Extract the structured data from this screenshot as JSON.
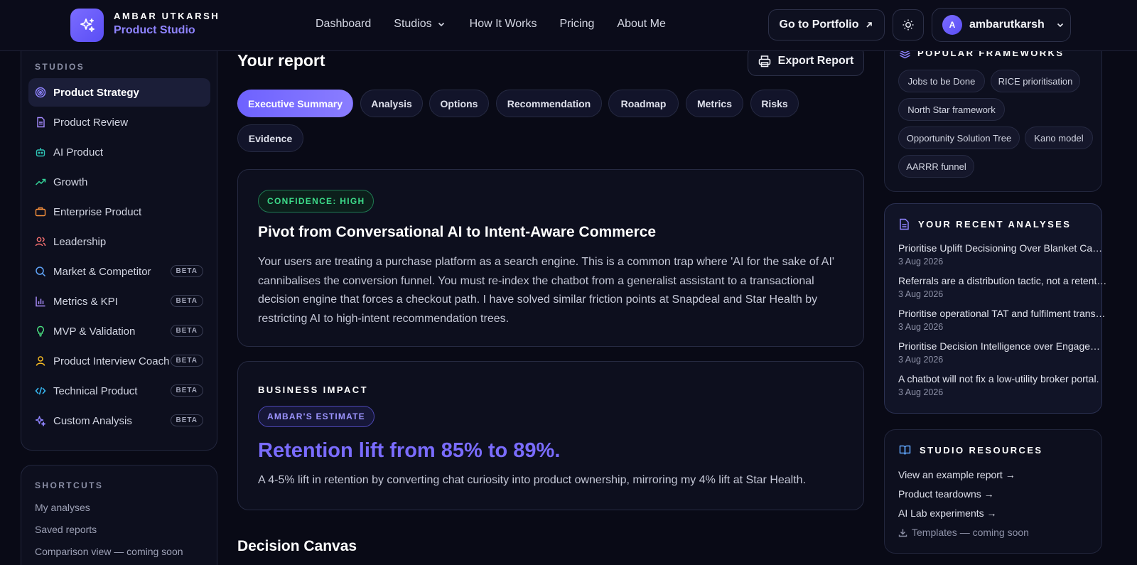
{
  "brand": {
    "line1": "AMBAR UTKARSH",
    "line2": "Product Studio"
  },
  "nav": {
    "dashboard": "Dashboard",
    "studios": "Studios",
    "how_it_works": "How It Works",
    "pricing": "Pricing",
    "about": "About Me",
    "portfolio_button": "Go to Portfolio",
    "user_initial": "A",
    "username": "ambarutkarsh"
  },
  "sidebar": {
    "studios_label": "STUDIOS",
    "items": [
      {
        "label": "Product Strategy",
        "icon": "target-icon",
        "beta": "",
        "active": true
      },
      {
        "label": "Product Review",
        "icon": "document-icon",
        "beta": ""
      },
      {
        "label": "AI Product",
        "icon": "bot-icon",
        "beta": ""
      },
      {
        "label": "Growth",
        "icon": "trending-up-icon",
        "beta": ""
      },
      {
        "label": "Enterprise Product",
        "icon": "briefcase-icon",
        "beta": ""
      },
      {
        "label": "Leadership",
        "icon": "users-icon",
        "beta": ""
      },
      {
        "label": "Market & Competitor",
        "icon": "search-icon",
        "beta": "BETA"
      },
      {
        "label": "Metrics & KPI",
        "icon": "bar-chart-icon",
        "beta": "BETA"
      },
      {
        "label": "MVP & Validation",
        "icon": "lightbulb-icon",
        "beta": "BETA"
      },
      {
        "label": "Product Interview Coach",
        "icon": "user-icon",
        "beta": "BETA"
      },
      {
        "label": "Technical Product",
        "icon": "code-icon",
        "beta": "BETA"
      },
      {
        "label": "Custom Analysis",
        "icon": "sparkles-icon",
        "beta": "BETA"
      }
    ],
    "shortcuts_label": "SHORTCUTS",
    "shortcuts": [
      "My analyses",
      "Saved reports",
      "Comparison view — coming soon"
    ]
  },
  "main": {
    "title": "Your report",
    "export_button": "Export Report",
    "tabs": [
      "Executive Summary",
      "Analysis",
      "Options",
      "Recommendation",
      "Roadmap",
      "Metrics",
      "Risks",
      "Evidence"
    ],
    "summary": {
      "confidence": "CONFIDENCE: HIGH",
      "heading": "Pivot from Conversational AI to Intent-Aware Commerce",
      "body": "Your users are treating a purchase platform as a search engine. This is a common trap where 'AI for the sake of AI' cannibalises the conversion funnel. You must re-index the chatbot from a generalist assistant to a transactional decision engine that forces a checkout path. I have solved similar friction points at Snapdeal and Star Health by restricting AI to high-intent recommendation trees."
    },
    "impact": {
      "label": "BUSINESS IMPACT",
      "badge": "AMBAR'S ESTIMATE",
      "heading": "Retention lift from 85% to 89%.",
      "body": "A 4-5% lift in retention by converting chat curiosity into product ownership, mirroring my 4% lift at Star Health."
    },
    "canvas_title": "Decision Canvas"
  },
  "right": {
    "frameworks_label": "POPULAR FRAMEWORKS",
    "frameworks": [
      "Jobs to be Done",
      "RICE prioritisation",
      "North Star framework",
      "Opportunity Solution Tree",
      "Kano model",
      "AARRR funnel"
    ],
    "recent_label": "YOUR RECENT ANALYSES",
    "recent": [
      {
        "title": "Prioritise Uplift Decisioning Over Blanket Cam...",
        "date": "3 Aug 2026"
      },
      {
        "title": "Referrals are a distribution tactic, not a retenti...",
        "date": "3 Aug 2026"
      },
      {
        "title": "Prioritise operational TAT and fulfilment transp...",
        "date": "3 Aug 2026"
      },
      {
        "title": "Prioritise Decision Intelligence over Engageme...",
        "date": "3 Aug 2026"
      },
      {
        "title": "A chatbot will not fix a low-utility broker portal.",
        "date": "3 Aug 2026"
      }
    ],
    "resources_label": "STUDIO RESOURCES",
    "resources": [
      "View an example report →",
      "Product teardowns →",
      "AI Lab experiments →"
    ],
    "resources_soon": "Templates — coming soon"
  },
  "colors": {
    "background": "#090a16",
    "accent": "#7a6cff",
    "confidence_green": "#3ddc8a",
    "panel": "#0d0f1e"
  }
}
